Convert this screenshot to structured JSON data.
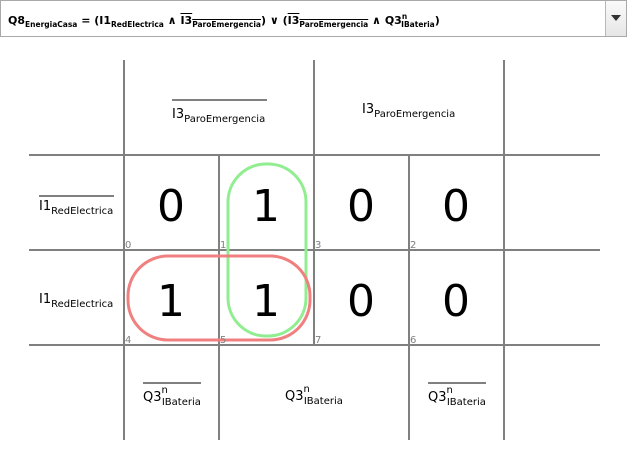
{
  "formula_bar": {
    "expression_parts": {
      "lhs": "Q8",
      "lhs_sub": "EnergiaCasa",
      "eq": " = (",
      "t1": "I1",
      "t1_sub": "RedElectrica",
      "and1": " ∧ ",
      "t2": "I3",
      "t2_sub": "ParoEmergencia",
      "or": ") ∨ (",
      "t3": "I3",
      "t3_sub": "ParoEmergencia",
      "and2": " ∧ ",
      "t4": "Q3",
      "t4_sup": "n",
      "t4_sub": "IBateria",
      "close": ")"
    },
    "dropdown_icon": "chevron-down-icon"
  },
  "kmap": {
    "col_groups": [
      {
        "var": "I3",
        "sub": "ParoEmergencia",
        "negated": true
      },
      {
        "var": "I3",
        "sub": "ParoEmergencia",
        "negated": false
      }
    ],
    "row_labels": [
      {
        "var": "I1",
        "sub": "RedElectrica",
        "negated": true
      },
      {
        "var": "I1",
        "sub": "RedElectrica",
        "negated": false
      }
    ],
    "bottom_labels": [
      {
        "var": "Q3",
        "sup": "n",
        "sub": "IBateria",
        "negated": true
      },
      {
        "var": "Q3",
        "sup": "n",
        "sub": "IBateria",
        "negated": false
      },
      {
        "var": "Q3",
        "sup": "n",
        "sub": "IBateria",
        "negated": true
      }
    ],
    "cells": [
      [
        {
          "value": "0",
          "index": "0"
        },
        {
          "value": "1",
          "index": "1"
        },
        {
          "value": "0",
          "index": "3"
        },
        {
          "value": "0",
          "index": "2"
        }
      ],
      [
        {
          "value": "1",
          "index": "4"
        },
        {
          "value": "1",
          "index": "5"
        },
        {
          "value": "0",
          "index": "7"
        },
        {
          "value": "0",
          "index": "6"
        }
      ]
    ],
    "groups": [
      {
        "color": "#90ee90",
        "cells": "column 1 (index 1, 5)"
      },
      {
        "color": "#f08080",
        "cells": "row 1 (index 4, 5)"
      }
    ]
  }
}
